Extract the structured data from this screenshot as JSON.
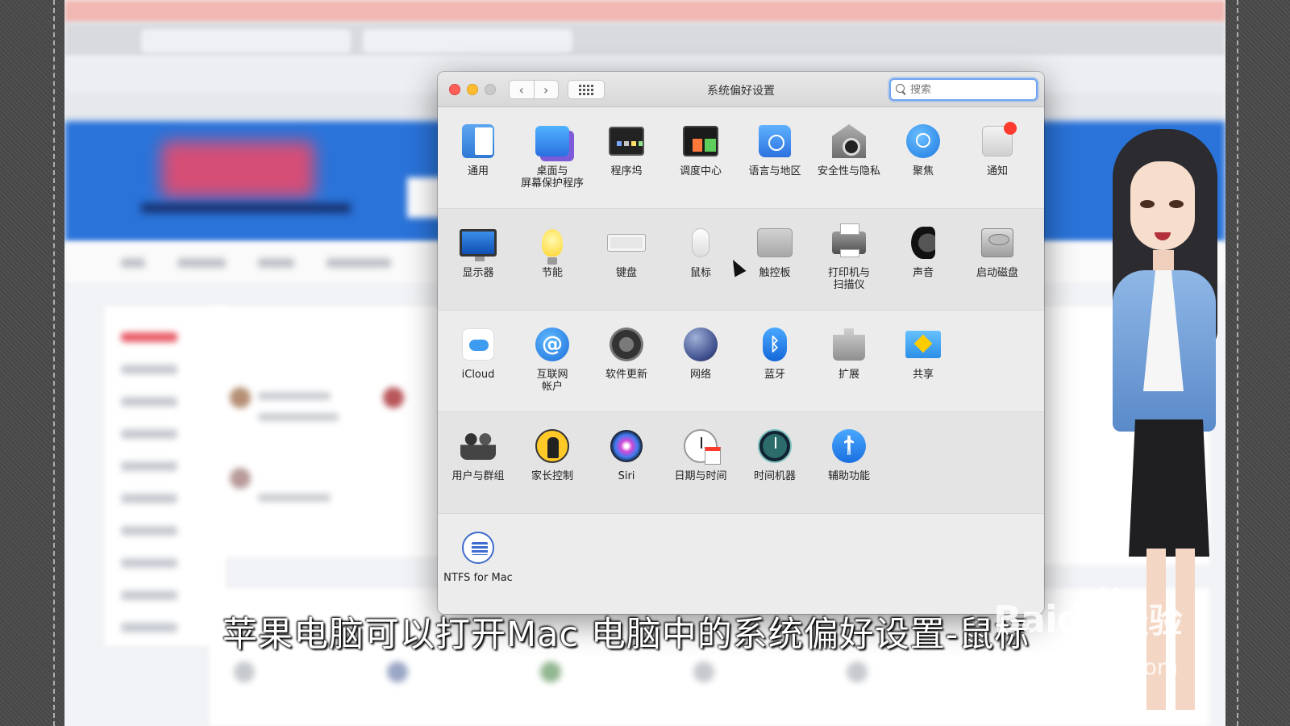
{
  "window": {
    "title": "系统偏好设置",
    "search_placeholder": "搜索",
    "back_label": "‹",
    "forward_label": "›"
  },
  "rows": [
    [
      {
        "label": "通用",
        "icon": "general-icon"
      },
      {
        "label": "桌面与\n屏幕保护程序",
        "icon": "desktop-screensaver-icon"
      },
      {
        "label": "程序坞",
        "icon": "dock-icon"
      },
      {
        "label": "调度中心",
        "icon": "mission-control-icon"
      },
      {
        "label": "语言与地区",
        "icon": "language-region-icon"
      },
      {
        "label": "安全性与隐私",
        "icon": "security-privacy-icon"
      },
      {
        "label": "聚焦",
        "icon": "spotlight-icon"
      },
      {
        "label": "通知",
        "icon": "notifications-icon"
      }
    ],
    [
      {
        "label": "显示器",
        "icon": "displays-icon"
      },
      {
        "label": "节能",
        "icon": "energy-saver-icon"
      },
      {
        "label": "键盘",
        "icon": "keyboard-icon"
      },
      {
        "label": "鼠标",
        "icon": "mouse-icon"
      },
      {
        "label": "触控板",
        "icon": "trackpad-icon"
      },
      {
        "label": "打印机与\n扫描仪",
        "icon": "printer-scanner-icon"
      },
      {
        "label": "声音",
        "icon": "sound-icon"
      },
      {
        "label": "启动磁盘",
        "icon": "startup-disk-icon"
      }
    ],
    [
      {
        "label": "iCloud",
        "icon": "icloud-icon"
      },
      {
        "label": "互联网\n帐户",
        "icon": "internet-accounts-icon"
      },
      {
        "label": "软件更新",
        "icon": "software-update-icon"
      },
      {
        "label": "网络",
        "icon": "network-icon"
      },
      {
        "label": "蓝牙",
        "icon": "bluetooth-icon"
      },
      {
        "label": "扩展",
        "icon": "extensions-icon"
      },
      {
        "label": "共享",
        "icon": "sharing-icon"
      }
    ],
    [
      {
        "label": "用户与群组",
        "icon": "users-groups-icon"
      },
      {
        "label": "家长控制",
        "icon": "parental-controls-icon"
      },
      {
        "label": "Siri",
        "icon": "siri-icon"
      },
      {
        "label": "日期与时间",
        "icon": "date-time-icon"
      },
      {
        "label": "时间机器",
        "icon": "time-machine-icon"
      },
      {
        "label": "辅助功能",
        "icon": "accessibility-icon"
      }
    ],
    [
      {
        "label": "NTFS for Mac",
        "icon": "ntfs-for-mac-icon"
      }
    ]
  ],
  "icon_glyphs": {
    "internet": "@",
    "bluetooth": "ᛒ"
  },
  "subtitle": "苹果电脑可以打开Mac 电脑中的系统偏好设置-鼠标",
  "watermark": {
    "brand": "Baidu",
    "product": "经验",
    "url": "jingyan.baidu.com"
  }
}
